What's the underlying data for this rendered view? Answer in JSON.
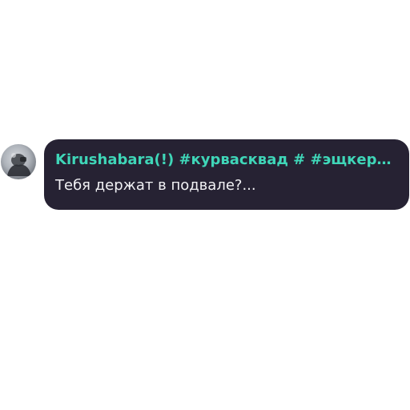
{
  "message": {
    "author": "Kirushabara(!) #курвасквад # #эщкере #...",
    "text": "Тебя держат в подвале?...",
    "author_color": "#3fd6b8",
    "bubble_color": "#262233"
  }
}
